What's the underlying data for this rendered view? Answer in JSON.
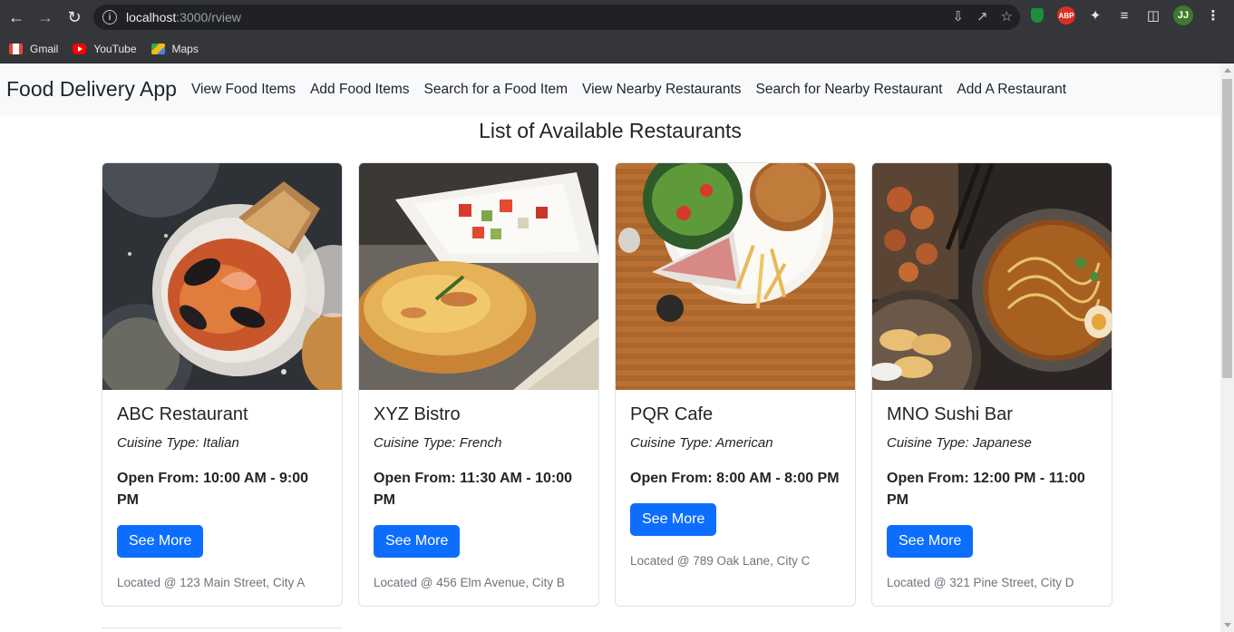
{
  "browser": {
    "url_host": "localhost",
    "url_rest": ":3000/rview",
    "bookmarks": [
      {
        "label": "Gmail",
        "icon": "gmail-icon"
      },
      {
        "label": "YouTube",
        "icon": "youtube-icon"
      },
      {
        "label": "Maps",
        "icon": "maps-icon"
      }
    ],
    "avatar_initials": "JJ",
    "abp_label": "ABP"
  },
  "navbar": {
    "brand": "Food Delivery App",
    "links": [
      "View Food Items",
      "Add Food Items",
      "Search for a Food Item",
      "View Nearby Restaurants",
      "Search for Nearby Restaurant",
      "Add A Restaurant"
    ]
  },
  "page": {
    "heading": "List of Available Restaurants"
  },
  "restaurants": [
    {
      "name": "ABC Restaurant",
      "cuisine": "Cuisine Type: Italian",
      "hours": "Open From: 10:00 AM - 9:00 PM",
      "button": "See More",
      "location": "Located @ 123 Main Street, City A"
    },
    {
      "name": "XYZ Bistro",
      "cuisine": "Cuisine Type: French",
      "hours": "Open From: 11:30 AM - 10:00 PM",
      "button": "See More",
      "location": "Located @ 456 Elm Avenue, City B"
    },
    {
      "name": "PQR Cafe",
      "cuisine": "Cuisine Type: American",
      "hours": "Open From: 8:00 AM - 8:00 PM",
      "button": "See More",
      "location": "Located @ 789 Oak Lane, City C"
    },
    {
      "name": "MNO Sushi Bar",
      "cuisine": "Cuisine Type: Japanese",
      "hours": "Open From: 12:00 PM - 11:00 PM",
      "button": "See More",
      "location": "Located @ 321 Pine Street, City D"
    }
  ],
  "colors": {
    "primary": "#0d6efd",
    "navbar_bg": "#f8f9fa",
    "chrome_bg": "#35363a"
  }
}
